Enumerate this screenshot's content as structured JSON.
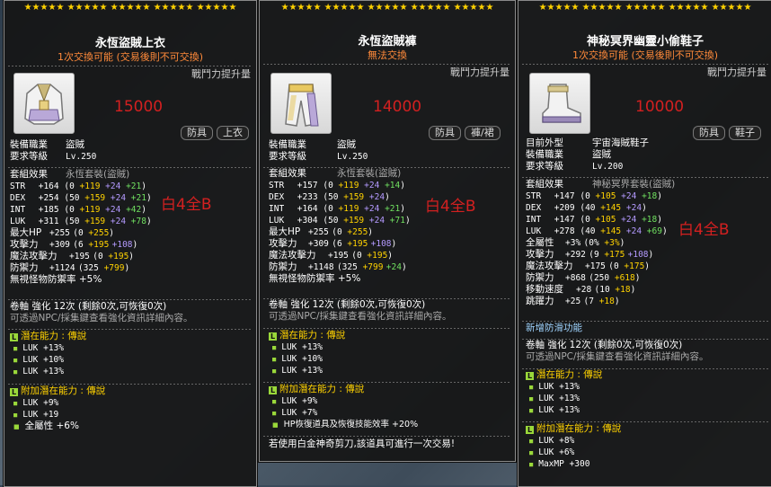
{
  "annotations": {
    "white4": "白4全B"
  },
  "cards": [
    {
      "stars": "★★★★★  ★★★★★  ★★★★★  ★★★★★  ★★★★★",
      "title": "永恆盜賊上衣",
      "trade": "1次交換可能 (交易後則不可交換)",
      "power_label": "戰鬥力提升量",
      "power_value": "15000",
      "tags": [
        "防具",
        "上衣"
      ],
      "info": [
        {
          "label": "裝備職業",
          "value": "盜賊"
        },
        {
          "label": "要求等級",
          "value": "Lv.250"
        }
      ],
      "set_label": "套組效果",
      "set_value": "永恆套裝(盜賊)",
      "stats": [
        {
          "name": "STR",
          "total": "+164",
          "base": "0",
          "flame": "+119",
          "star": "+24",
          "scroll": "+21"
        },
        {
          "name": "DEX",
          "total": "+254",
          "base": "50",
          "flame": "+159",
          "star": "+24",
          "scroll": "+21"
        },
        {
          "name": "INT",
          "total": "+185",
          "base": "0",
          "flame": "+119",
          "star": "+24",
          "scroll": "+42"
        },
        {
          "name": "LUK",
          "total": "+311",
          "base": "50",
          "flame": "+159",
          "star": "+24",
          "scroll": "+78"
        }
      ],
      "stats2": [
        {
          "name": "最大HP",
          "text": "+255",
          "paren": "(0 ",
          "a": "+255",
          "b": "",
          "close": ")"
        },
        {
          "name": "攻擊力",
          "text": "+309",
          "paren": "(6 ",
          "a": "+195",
          "b": "+108",
          "close": ")"
        },
        {
          "name": "魔法攻擊力",
          "text": "+195",
          "paren": "(0 ",
          "a": "+195",
          "b": "",
          "close": ")"
        },
        {
          "name": "防禦力",
          "text": "+1124",
          "paren": "(325 ",
          "a": "+799",
          "b": "",
          "close": ")"
        }
      ],
      "ignore": "無視怪物防禦率   +5%",
      "scroll": "卷軸 強化 12次 (剩餘0次,可恢復0次)",
      "npc": "可透過NPC/採集鍵查看強化資訊詳細內容。",
      "pot_label": "潛在能力 : 傳說",
      "pot_lines": [
        "LUK +13%",
        "LUK +10%",
        "LUK +13%"
      ],
      "bpot_label": "附加潛在能力 : 傳說",
      "bpot_lines": [
        "LUK +9%",
        "LUK +19",
        "全屬性 +6%"
      ]
    },
    {
      "stars": "★★★★★  ★★★★★  ★★★★★  ★★★★★  ★★★★★",
      "title": "永恆盜賊褲",
      "trade": "無法交換",
      "power_label": "戰鬥力提升量",
      "power_value": "14000",
      "tags": [
        "防具",
        "褲/裙"
      ],
      "info": [
        {
          "label": "裝備職業",
          "value": "盜賊"
        },
        {
          "label": "要求等級",
          "value": "Lv.250"
        }
      ],
      "set_label": "套組效果",
      "set_value": "永恆套裝(盜賊)",
      "stats": [
        {
          "name": "STR",
          "total": "+157",
          "base": "0",
          "flame": "+119",
          "star": "+24",
          "scroll": "+14"
        },
        {
          "name": "DEX",
          "total": "+233",
          "base": "50",
          "flame": "+159",
          "star": "+24",
          "scroll": ""
        },
        {
          "name": "INT",
          "total": "+164",
          "base": "0",
          "flame": "+119",
          "star": "+24",
          "scroll": "+21"
        },
        {
          "name": "LUK",
          "total": "+304",
          "base": "50",
          "flame": "+159",
          "star": "+24",
          "scroll": "+71"
        }
      ],
      "stats2": [
        {
          "name": "最大HP",
          "text": "+255",
          "paren": "(0 ",
          "a": "+255",
          "b": "",
          "close": ")"
        },
        {
          "name": "攻擊力",
          "text": "+309",
          "paren": "(6 ",
          "a": "+195",
          "b": "+108",
          "close": ")"
        },
        {
          "name": "魔法攻擊力",
          "text": "+195",
          "paren": "(0 ",
          "a": "+195",
          "b": "",
          "close": ")"
        },
        {
          "name": "防禦力",
          "text": "+1148",
          "paren": "(325 ",
          "a": "+799",
          "b": "+24",
          "close": ")"
        }
      ],
      "ignore": "無視怪物防禦率   +5%",
      "scroll": "卷軸 強化 12次 (剩餘0次,可恢復0次)",
      "npc": "可透過NPC/採集鍵查看強化資訊詳細內容。",
      "pot_label": "潛在能力 : 傳說",
      "pot_lines": [
        "LUK +13%",
        "LUK +10%",
        "LUK +13%"
      ],
      "bpot_label": "附加潛在能力 : 傳說",
      "bpot_lines": [
        "LUK +9%",
        "LUK +7%",
        "HP恢復道具及恢復技能效率 +20%"
      ],
      "footer": "若使用白金神奇剪刀,該道具可進行一次交易!"
    },
    {
      "stars": "★★★★★  ★★★★★  ★★★★★  ★★★★★  ★★★★★",
      "title": "神秘冥界幽靈小偷鞋子",
      "trade": "1次交換可能 (交易後則不可交換)",
      "power_label": "戰鬥力提升量",
      "power_value": "10000",
      "tags": [
        "防具",
        "鞋子"
      ],
      "info": [
        {
          "label": "目前外型",
          "value": "宇宙海賊鞋子"
        },
        {
          "label": "裝備職業",
          "value": "盜賊"
        },
        {
          "label": "要求等級",
          "value": "Lv.200"
        }
      ],
      "set_label": "套組效果",
      "set_value": "神秘冥界套裝(盜賊)",
      "stats": [
        {
          "name": "STR",
          "total": "+147",
          "base": "0",
          "flame": "+105",
          "star": "+24",
          "scroll": "+18"
        },
        {
          "name": "DEX",
          "total": "+209",
          "base": "40",
          "flame": "+145",
          "star": "+24",
          "scroll": ""
        },
        {
          "name": "INT",
          "total": "+147",
          "base": "0",
          "flame": "+105",
          "star": "+24",
          "scroll": "+18"
        },
        {
          "name": "LUK",
          "total": "+278",
          "base": "40",
          "flame": "+145",
          "star": "+24",
          "scroll": "+69"
        }
      ],
      "stats2": [
        {
          "name": "全屬性",
          "text": "+3%",
          "paren": "(0% ",
          "a": "+3%",
          "b": "",
          "close": ")"
        },
        {
          "name": "攻擊力",
          "text": "+292",
          "paren": "(9 ",
          "a": "+175",
          "b": "+108",
          "close": ")"
        },
        {
          "name": "魔法攻擊力",
          "text": "+175",
          "paren": "(0 ",
          "a": "+175",
          "b": "",
          "close": ")"
        },
        {
          "name": "防禦力",
          "text": "+868",
          "paren": "(250 ",
          "a": "+618",
          "b": "",
          "close": ")"
        },
        {
          "name": "移動速度",
          "text": "+28",
          "paren": "(10 ",
          "a": "+18",
          "b": "",
          "close": ")"
        },
        {
          "name": "跳躍力",
          "text": "+25",
          "paren": "(7 ",
          "a": "+18",
          "b": "",
          "close": ")"
        }
      ],
      "new_func": "新增防滑功能",
      "scroll": "卷軸 強化 12次 (剩餘0次,可恢復0次)",
      "npc": "可透過NPC/採集鍵查看強化資訊詳細內容。",
      "pot_label": "潛在能力 : 傳說",
      "pot_lines": [
        "LUK +13%",
        "LUK +13%",
        "LUK +13%"
      ],
      "bpot_label": "附加潛在能力 : 傳說",
      "bpot_lines": [
        "LUK +8%",
        "LUK +6%",
        "MaxMP +300"
      ]
    }
  ]
}
